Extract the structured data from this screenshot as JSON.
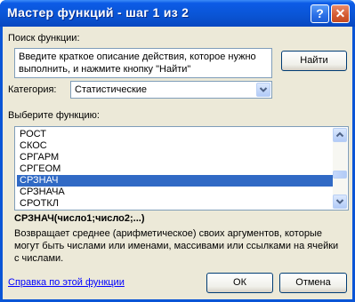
{
  "window": {
    "title": "Мастер функций - шаг 1 из 2",
    "help_button": "?",
    "close_button": "✕"
  },
  "search": {
    "label": "Поиск функции:",
    "placeholder_text": "Введите краткое описание действия, которое нужно выполнить, и нажмите кнопку \"Найти\"",
    "find_button": "Найти"
  },
  "category": {
    "label": "Категория:",
    "selected": "Статистические"
  },
  "functions": {
    "label": "Выберите функцию:",
    "items": [
      "РОСТ",
      "СКОС",
      "СРГАРМ",
      "СРГЕОМ",
      "СРЗНАЧ",
      "СРЗНАЧА",
      "СРОТКЛ"
    ],
    "selected": "СРЗНАЧ"
  },
  "details": {
    "signature": "СРЗНАЧ(число1;число2;...)",
    "description": "Возвращает среднее (арифметическое) своих аргументов, которые могут быть числами или именами, массивами или ссылками на ячейки с числами."
  },
  "footer": {
    "help_link": "Справка по этой функции",
    "ok_button": "ОК",
    "cancel_button": "Отмена"
  },
  "colors": {
    "title_bar": "#0a55d6",
    "dialog_face": "#ece9d8",
    "selection": "#316ac5",
    "link": "#0000ff"
  }
}
